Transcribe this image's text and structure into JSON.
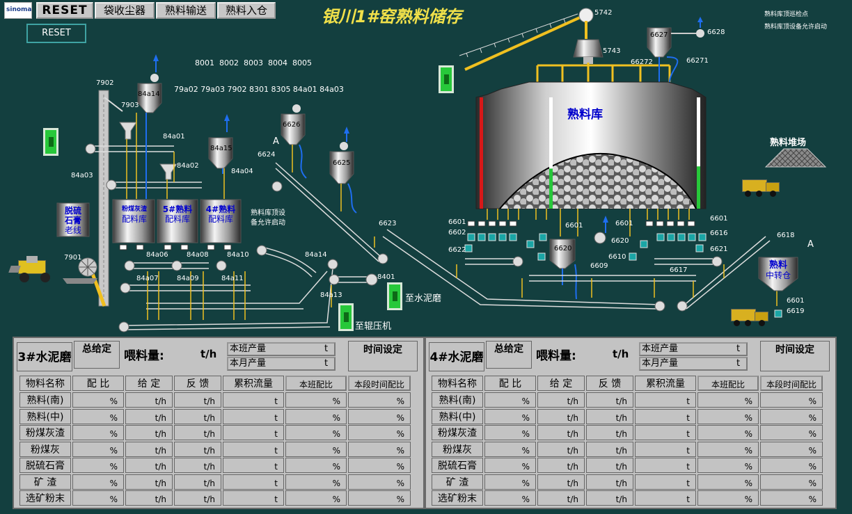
{
  "logo": "sinoma",
  "top_buttons": [
    "RESET",
    "袋收尘器",
    "熟料输送",
    "熟料入仓"
  ],
  "reset2": "RESET",
  "title": "银川1#窑熟料储存",
  "notes": [
    "熟料库顶巡检点",
    "熟料库顶设备允许启动"
  ],
  "equipment_rows": {
    "row1": "8001  8002  8003  8004  8005",
    "row2": "79a02 79a03 7902 8301 8305 84a01 84a03"
  },
  "tags": {
    "t5742": "5742",
    "t5743": "5743",
    "t6627": "6627",
    "t6628": "6628",
    "t66272": "66272",
    "t66271": "66271",
    "t7902": "7902",
    "t7903": "7903",
    "t84a14": "84a14",
    "t84a01": "84a01",
    "t84a02": "84a02",
    "t84a03": "84a03",
    "t84a15": "84a15",
    "t84a04": "84a04",
    "t6626": "6626",
    "t6624": "6624",
    "tA1": "A",
    "t6625": "6625",
    "t6623": "6623",
    "t7901": "7901",
    "t84a06": "84a06",
    "t84a08": "84a08",
    "t84a10": "84a10",
    "t84a07": "84a07",
    "t84a09": "84a09",
    "t84a11": "84a11",
    "t84a14b": "84a14",
    "t8401": "8401",
    "t84a13": "84a13",
    "t6601": "6601",
    "t6602": "6602",
    "t6622": "6622",
    "t6601b": "6601",
    "t6601c": "6601",
    "t6620": "6620",
    "t6620b": "6620",
    "t6610": "6610",
    "t6609": "6609",
    "t6617": "6617",
    "t6601d": "6601",
    "t6616": "6616",
    "t6621": "6621",
    "t6618": "6618",
    "tA2": "A",
    "t6601e": "6601",
    "t6619": "6619"
  },
  "silo": {
    "name": "熟料库",
    "left_fill": 1.0,
    "mid_fill": 0.36,
    "right_fill": 0.38
  },
  "left_bin": [
    "脱硫",
    "石膏",
    "老线"
  ],
  "bins": [
    {
      "line1": "粉煤灰渣",
      "line2": "配料库"
    },
    {
      "line1": "5#熟料",
      "line2": "配料库"
    },
    {
      "line1": "4#熟料",
      "line2": "配料库"
    }
  ],
  "stockpile": "熟料堆场",
  "mid_bin": [
    "熟料",
    "中转仓"
  ],
  "silo_note": "熟料库顶设\n备允许启动",
  "to_cement_mill": "至水泥磨",
  "to_roller_press": "至辊压机",
  "panels": [
    {
      "name": "3#水泥磨",
      "total": "总给定",
      "feed_label": "喂料量:",
      "feed_unit": "t/h",
      "shift_prod": "本班产量",
      "month_prod": "本月产量",
      "prod_unit": "t",
      "time_set": "时间设定",
      "columns": [
        "物料名称",
        "配 比",
        "给 定",
        "反 馈",
        "累积流量",
        "本班配比",
        "本段时间配比"
      ],
      "materials": [
        "熟料(南)",
        "熟料(中)",
        "粉煤灰渣",
        "粉煤灰",
        "脱硫石膏",
        "矿 渣",
        "选矿粉末"
      ],
      "units": [
        "%",
        "t/h",
        "t/h",
        "t",
        "%",
        "%"
      ]
    },
    {
      "name": "4#水泥磨",
      "total": "总给定",
      "feed_label": "喂料量:",
      "feed_unit": "t/h",
      "shift_prod": "本班产量",
      "month_prod": "本月产量",
      "prod_unit": "t",
      "time_set": "时间设定",
      "columns": [
        "物料名称",
        "配 比",
        "给 定",
        "反 馈",
        "累积流量",
        "本班配比",
        "本段时间配比"
      ],
      "materials": [
        "熟料(南)",
        "熟料(中)",
        "粉煤灰渣",
        "粉煤灰",
        "脱硫石膏",
        "矿 渣",
        "选矿粉末"
      ],
      "units": [
        "%",
        "t/h",
        "t/h",
        "t",
        "%",
        "%"
      ]
    }
  ],
  "colors": {
    "background": "#133f3f",
    "title": "#f0e04a",
    "conveyor": "#f0c020",
    "run_green": "#27c83a",
    "alarm_red": "#d81818"
  }
}
